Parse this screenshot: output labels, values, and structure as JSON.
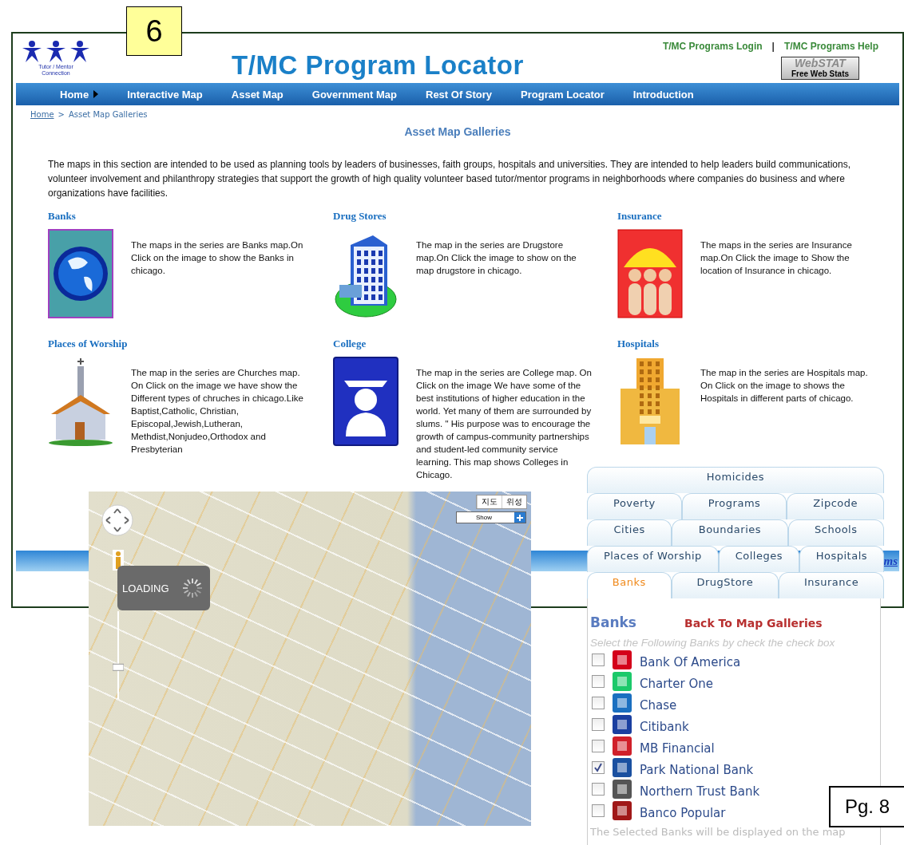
{
  "slide_number": "6",
  "page_label": "Pg. 8",
  "header": {
    "logo_lines": [
      "Tutor / Mentor",
      "Connection"
    ],
    "title": "T/MC Program Locator",
    "links": [
      "T/MC Programs Login",
      "T/MC Programs Help"
    ],
    "separator": "|",
    "badge": {
      "title": "WebSTAT",
      "subtitle": "Free Web Stats"
    }
  },
  "nav": [
    {
      "label": "Home",
      "has_menu": true
    },
    {
      "label": "Interactive Map",
      "has_menu": false
    },
    {
      "label": "Asset Map",
      "has_menu": false
    },
    {
      "label": "Government Map",
      "has_menu": false
    },
    {
      "label": "Rest Of Story",
      "has_menu": false
    },
    {
      "label": "Program Locator",
      "has_menu": false
    },
    {
      "label": "Introduction",
      "has_menu": false
    }
  ],
  "breadcrumb": {
    "items": [
      "Home",
      "Asset Map Galleries"
    ],
    "separator": ">"
  },
  "page_title": "Asset Map Galleries",
  "intro": "The maps in this section are intended to be used as planning tools by leaders of businesses, faith groups, hospitals and universities. They are intended to help leaders build communications, volunteer involvement and philanthropy strategies that support the growth of high quality volunteer based tutor/mentor programs in neighborhoods where companies do business and where organizations have facilities.",
  "galleries": [
    {
      "title": "Banks",
      "kind": "globe",
      "text": "The maps in the series are Banks map.On Click on the image to show the Banks in chicago."
    },
    {
      "title": "Drug Stores",
      "kind": "building",
      "text": "The map in the series are Drugstore map.On Click the image to show on the map drugstore in chicago."
    },
    {
      "title": "Insurance",
      "kind": "umbrella",
      "text": "The maps in the series are Insurance map.On Click the image to Show the location of Insurance in chicago."
    },
    {
      "title": "Places of Worship",
      "kind": "church",
      "text": "The map in the series are Churches map. On Click on the image we have show the Different types of chruches in chicago.Like Baptist,Catholic, Christian, Episcopal,Jewish,Lutheran, Methdist,Nonjudeo,Orthodox and Presbyterian"
    },
    {
      "title": "College",
      "kind": "graduate",
      "text": "The map in the series are College map. On Click on the image We have some of the best institutions of higher education in the world. Yet many of them are surrounded by slums. \" His purpose was to encourage the growth of campus-community partnerships and student-led community service learning. This map shows Colleges in Chicago."
    },
    {
      "title": "Hospitals",
      "kind": "hospital",
      "text": "The map in the series are Hospitals map. On Click on the image to shows the Hospitals in different parts of chicago."
    }
  ],
  "footer_link": "ms",
  "map": {
    "type_buttons": [
      "지도",
      "위성"
    ],
    "layer_select": "Show",
    "loading": "LOADING",
    "zoom": {
      "level": 0.35
    }
  },
  "layer_tabs": [
    [
      {
        "label": "Homicides",
        "selected": false
      }
    ],
    [
      {
        "label": "Poverty",
        "selected": false
      },
      {
        "label": "Programs",
        "selected": false
      },
      {
        "label": "Zipcode",
        "selected": false
      }
    ],
    [
      {
        "label": "Cities",
        "selected": false
      },
      {
        "label": "Boundaries",
        "selected": false
      },
      {
        "label": "Schools",
        "selected": false
      }
    ],
    [
      {
        "label": "Places of Worship",
        "selected": false
      },
      {
        "label": "Colleges",
        "selected": false
      },
      {
        "label": "Hospitals",
        "selected": false
      }
    ],
    [
      {
        "label": "Banks",
        "selected": true
      },
      {
        "label": "DrugStore",
        "selected": false
      },
      {
        "label": "Insurance",
        "selected": false
      }
    ]
  ],
  "bank_panel": {
    "title": "Banks",
    "back_link": "Back To Map Galleries",
    "hint": "Select the Following Banks by check the check box",
    "banks": [
      {
        "name": "Bank Of America",
        "checked": false,
        "color": "#d4001a"
      },
      {
        "name": "Charter One",
        "checked": false,
        "color": "#1bc96a"
      },
      {
        "name": "Chase",
        "checked": false,
        "color": "#1a6fc0"
      },
      {
        "name": "Citibank",
        "checked": false,
        "color": "#1a3fa0"
      },
      {
        "name": "MB Financial",
        "checked": false,
        "color": "#d0202a"
      },
      {
        "name": "Park National Bank",
        "checked": true,
        "color": "#1a50a0"
      },
      {
        "name": "Northern Trust Bank",
        "checked": false,
        "color": "#555555"
      },
      {
        "name": "Banco Popular",
        "checked": false,
        "color": "#a01818"
      }
    ],
    "note": "The Selected Banks will be displayed on the map"
  }
}
